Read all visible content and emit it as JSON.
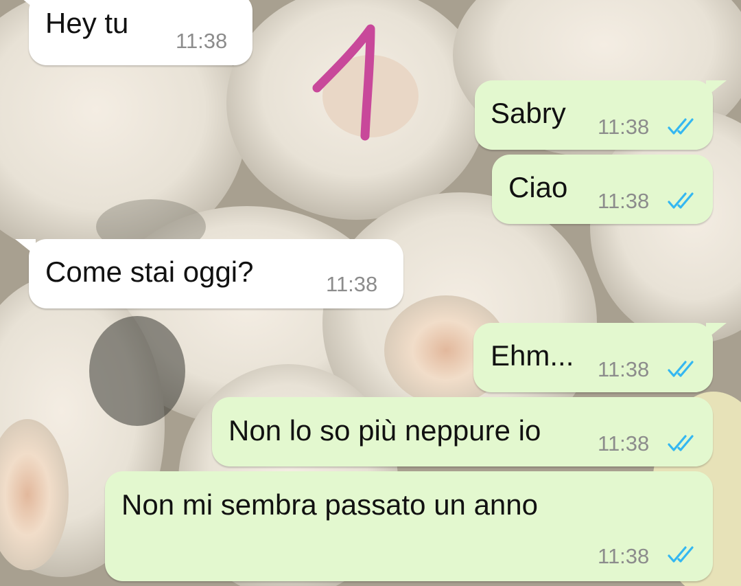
{
  "chat": {
    "messages": [
      {
        "direction": "incoming",
        "text": "Hey tu",
        "time": "11:38"
      },
      {
        "direction": "outgoing",
        "text": "Sabry",
        "time": "11:38",
        "status": "read"
      },
      {
        "direction": "outgoing",
        "text": "Ciao",
        "time": "11:38",
        "status": "read"
      },
      {
        "direction": "incoming",
        "text": "Come stai oggi?",
        "time": "11:38"
      },
      {
        "direction": "outgoing",
        "text": "Ehm...",
        "time": "11:38",
        "status": "read"
      },
      {
        "direction": "outgoing",
        "text": "Non lo so più neppure io",
        "time": "11:38",
        "status": "read"
      },
      {
        "direction": "outgoing",
        "text": "Non mi sembra passato un anno",
        "time": "11:38",
        "status": "read"
      }
    ]
  },
  "annotation": {
    "text": "1",
    "color": "#c8489a"
  },
  "colors": {
    "incoming_bubble": "#ffffff",
    "outgoing_bubble": "#e3f8cf",
    "read_tick": "#34b7f1",
    "timestamp": "#8c8c8c"
  },
  "icons": {
    "read_status": "double-check-icon"
  }
}
